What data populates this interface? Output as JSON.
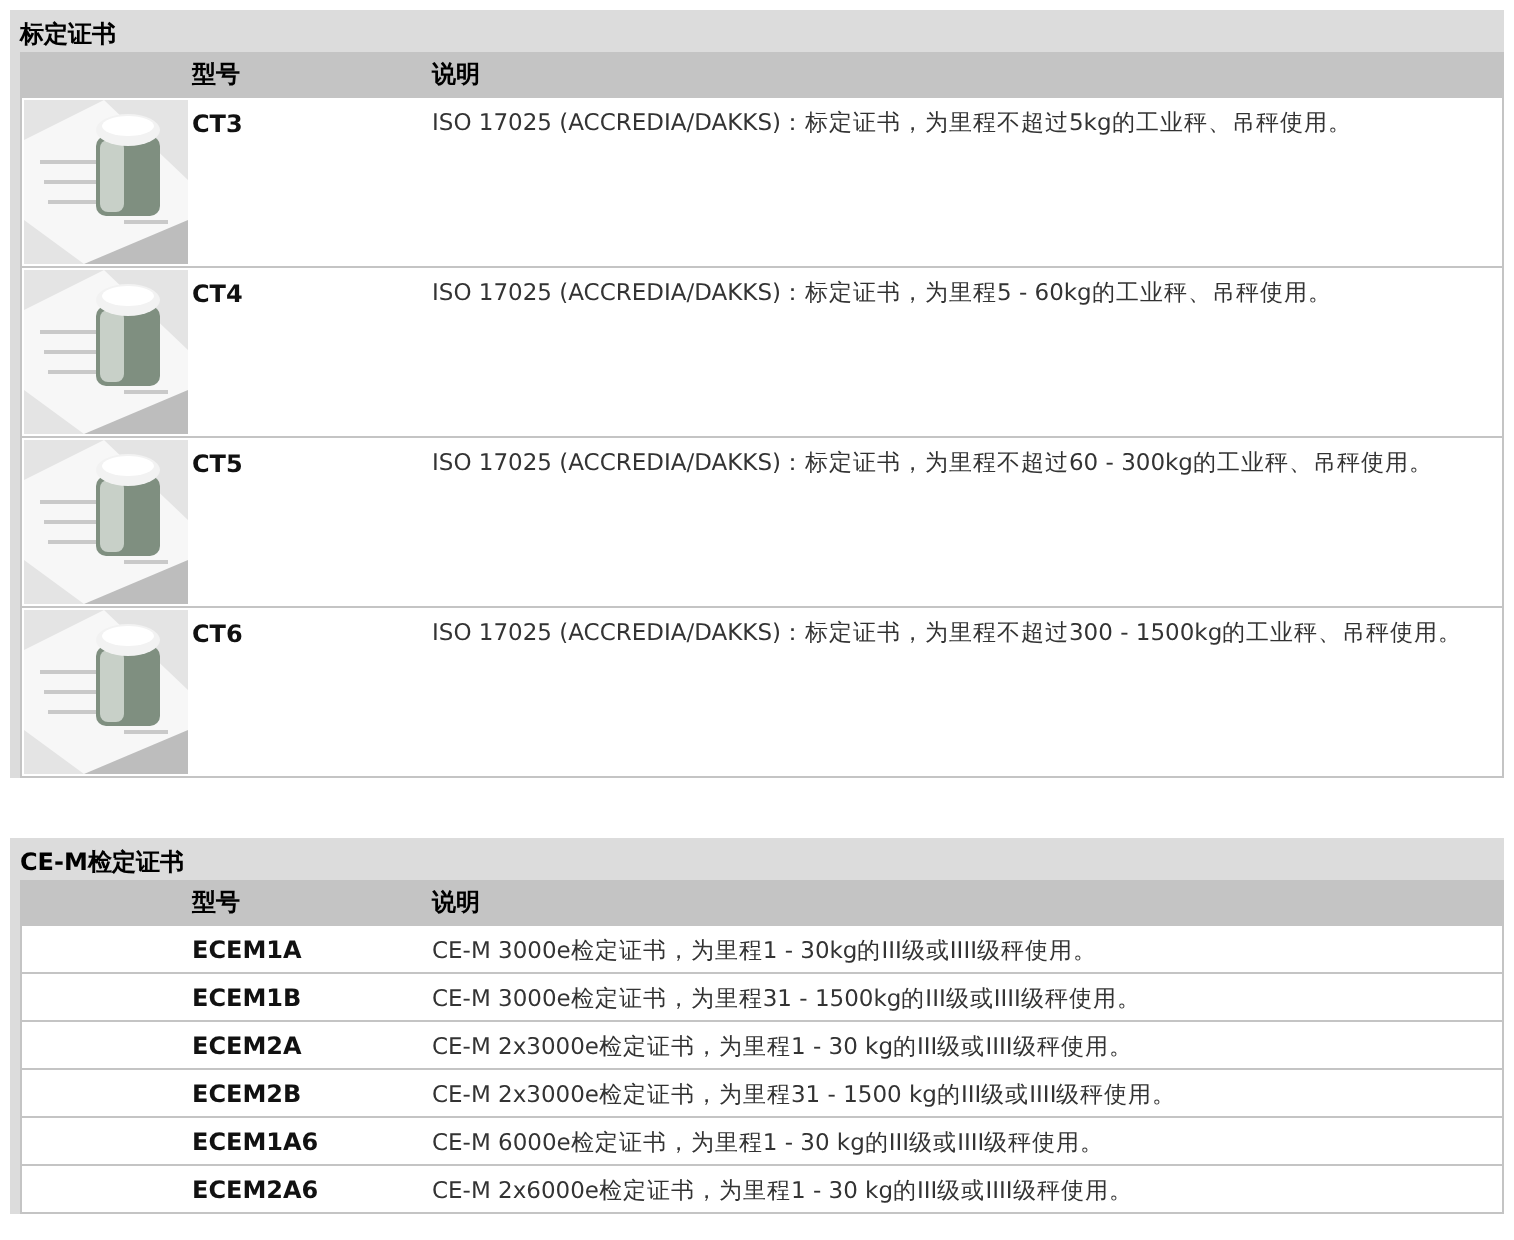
{
  "sections": [
    {
      "title": "标定证书",
      "columns": [
        "型号",
        "说明"
      ],
      "rows": [
        {
          "kind": "picture",
          "model": "CT3",
          "description": "ISO 17025 (ACCREDIA/DAKKS)：标定证书，为里程不超过5kg的工业秤、吊秤使用。"
        },
        {
          "kind": "picture",
          "model": "CT4",
          "description": "ISO 17025 (ACCREDIA/DAKKS)：标定证书，为里程5 - 60kg的工业秤、吊秤使用。"
        },
        {
          "kind": "picture",
          "model": "CT5",
          "description": "ISO 17025 (ACCREDIA/DAKKS)：标定证书，为里程不超过60 - 300kg的工业秤、吊秤使用。"
        },
        {
          "kind": "picture",
          "model": "CT6",
          "description": "ISO 17025 (ACCREDIA/DAKKS)：标定证书，为里程不超过300 - 1500kg的工业秤、吊秤使用。"
        }
      ]
    },
    {
      "title": "CE-M检定证书",
      "columns": [
        "型号",
        "说明"
      ],
      "rows": [
        {
          "kind": "text",
          "model": "ECEM1A",
          "description": "CE-M 3000e检定证书，为里程1 - 30kg的III级或IIII级秤使用。"
        },
        {
          "kind": "text",
          "model": "ECEM1B",
          "description": "CE-M 3000e检定证书，为里程31 - 1500kg的III级或IIII级秤使用。"
        },
        {
          "kind": "text",
          "model": "ECEM2A",
          "description": "CE-M 2x3000e检定证书，为里程1 - 30 kg的III级或IIII级秤使用。"
        },
        {
          "kind": "text",
          "model": "ECEM2B",
          "description": "CE-M 2x3000e检定证书，为里程31 - 1500 kg的III级或IIII级秤使用。"
        },
        {
          "kind": "text",
          "model": "ECEM1A6",
          "description": "CE-M 6000e检定证书，为里程1 - 30 kg的III级或IIII级秤使用。"
        },
        {
          "kind": "text",
          "model": "ECEM2A6",
          "description": "CE-M 2x6000e检定证书，为里程1 - 30 kg的III级或IIII级秤使用。"
        }
      ]
    }
  ]
}
